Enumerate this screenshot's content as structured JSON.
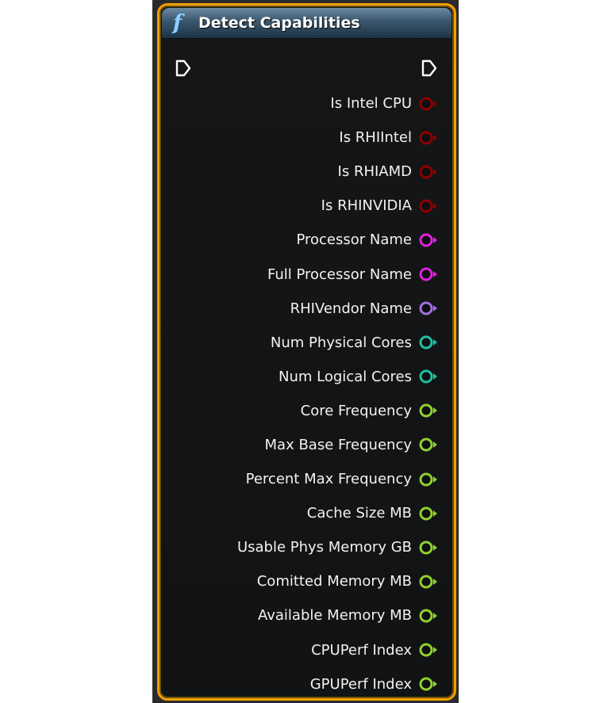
{
  "node": {
    "icon": "function-icon",
    "icon_glyph": "f",
    "title": "Detect Capabilities"
  },
  "colors": {
    "border": "#f0a000",
    "header": "#3d5a72",
    "bool": "#8b0000",
    "string": "#e020e0",
    "name": "#a070e0",
    "int": "#20c0a0",
    "float": "#90d030"
  },
  "pins": [
    {
      "label": "Is Intel CPU",
      "type": "bool"
    },
    {
      "label": "Is RHIIntel",
      "type": "bool"
    },
    {
      "label": "Is RHIAMD",
      "type": "bool"
    },
    {
      "label": "Is RHINVIDIA",
      "type": "bool"
    },
    {
      "label": "Processor Name",
      "type": "string"
    },
    {
      "label": "Full Processor Name",
      "type": "string"
    },
    {
      "label": "RHIVendor Name",
      "type": "name"
    },
    {
      "label": "Num Physical Cores",
      "type": "int"
    },
    {
      "label": "Num Logical Cores",
      "type": "int"
    },
    {
      "label": "Core Frequency",
      "type": "float"
    },
    {
      "label": "Max Base Frequency",
      "type": "float"
    },
    {
      "label": "Percent Max Frequency",
      "type": "float"
    },
    {
      "label": "Cache Size MB",
      "type": "float"
    },
    {
      "label": "Usable Phys Memory GB",
      "type": "float"
    },
    {
      "label": "Comitted Memory MB",
      "type": "float"
    },
    {
      "label": "Available Memory MB",
      "type": "float"
    },
    {
      "label": "CPUPerf Index",
      "type": "float"
    },
    {
      "label": "GPUPerf Index",
      "type": "float"
    }
  ]
}
